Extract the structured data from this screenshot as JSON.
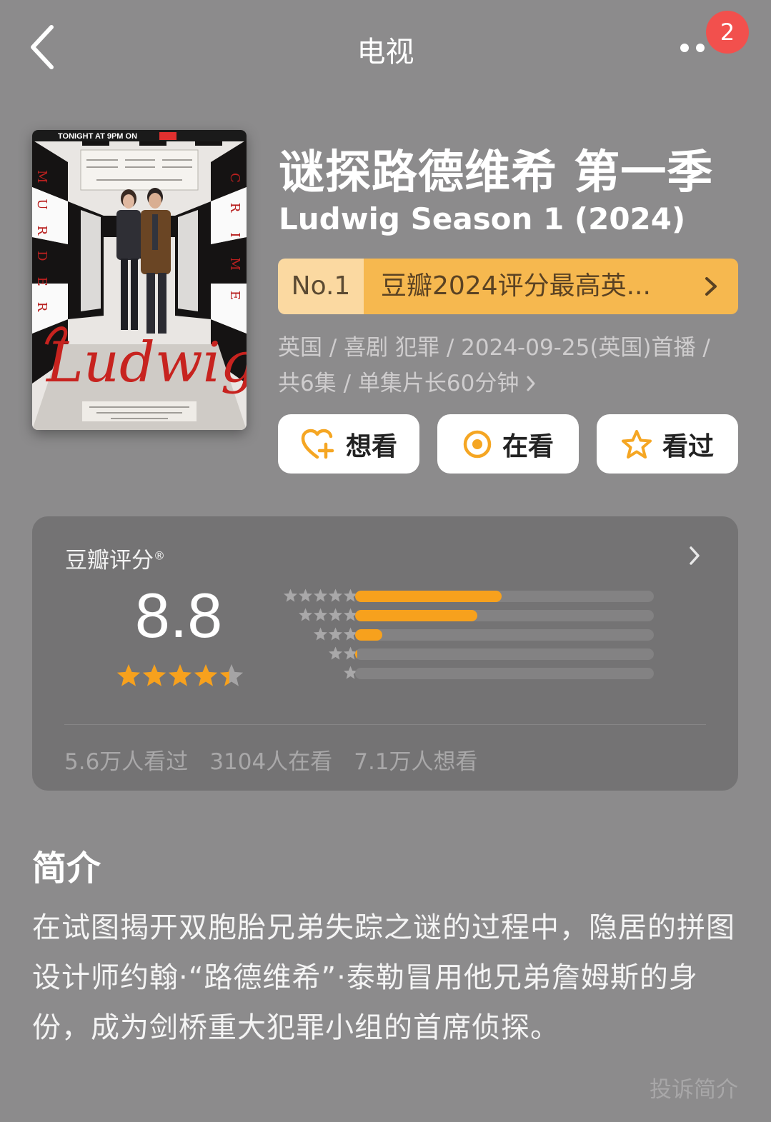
{
  "header": {
    "title": "电视",
    "notification_count": "2"
  },
  "poster": {
    "top_banner": "TONIGHT AT 9PM ON",
    "title_script": "Ludwig",
    "word_murder": "MURDER",
    "word_crime": "CRIME"
  },
  "show": {
    "title_cn": "谜探路德维希 第一季",
    "title_en": "Ludwig Season 1 (2024)",
    "rank_no": "No.1",
    "rank_text": "豆瓣2024评分最高英...",
    "meta_line1": "英国 / 喜剧 犯罪 / 2024-09-25(英国)首播 /",
    "meta_line2": "共6集 / 单集片长60分钟"
  },
  "actions": {
    "want": "想看",
    "watching": "在看",
    "watched": "看过"
  },
  "rating": {
    "label": "豆瓣评分",
    "reg_mark": "®",
    "score": "8.8",
    "star_value": 4.4,
    "distribution": [
      {
        "stars": 5,
        "fraction": 0.49
      },
      {
        "stars": 4,
        "fraction": 0.41
      },
      {
        "stars": 3,
        "fraction": 0.09
      },
      {
        "stars": 2,
        "fraction": 0.01
      },
      {
        "stars": 1,
        "fraction": 0.0
      }
    ],
    "watched_count": "5.6万人看过",
    "watching_count": "3104人在看",
    "want_count": "7.1万人想看"
  },
  "synopsis": {
    "heading": "简介",
    "body": "在试图揭开双胞胎兄弟失踪之谜的过程中，隐居的拼图设计师约翰·“路德维希”·泰勒冒用他兄弟詹姆斯的身份，成为剑桥重大犯罪小组的首席侦探。",
    "report": "投诉简介"
  },
  "colors": {
    "background": "#8c8b8c",
    "card": "#747374",
    "accent_orange": "#f7a11d",
    "badge_red": "#f2504d"
  }
}
